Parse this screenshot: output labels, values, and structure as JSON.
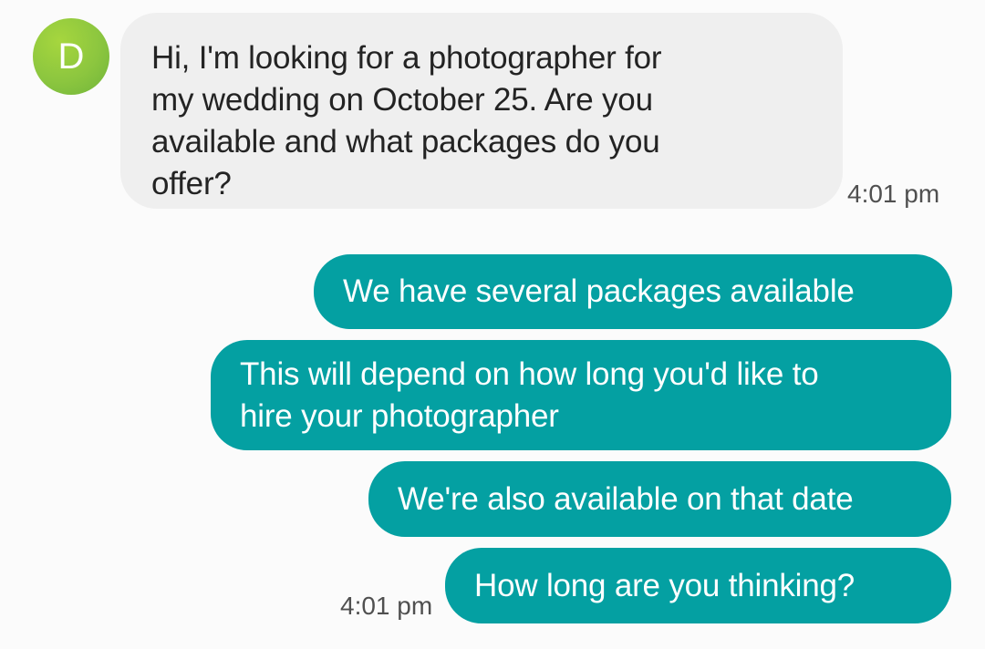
{
  "contact": {
    "initial": "D",
    "avatar_color": "#8cc63f"
  },
  "colors": {
    "incoming_bubble": "#efefef",
    "outgoing_bubble": "#04a0a2",
    "background": "#fbfbfb"
  },
  "messages": {
    "incoming": [
      {
        "lines": [
          "Hi, I'm looking for a photographer for",
          "my wedding on October 25. Are you",
          "available and what packages do you",
          "offer?"
        ],
        "time": "4:01 pm"
      }
    ],
    "outgoing": [
      {
        "lines": [
          "We have several packages available"
        ]
      },
      {
        "lines": [
          "This will depend on how long you'd like to",
          "hire your photographer"
        ]
      },
      {
        "lines": [
          "We're also available on that date"
        ]
      },
      {
        "lines": [
          "How long are you thinking?"
        ]
      }
    ],
    "outgoing_time": "4:01 pm"
  }
}
